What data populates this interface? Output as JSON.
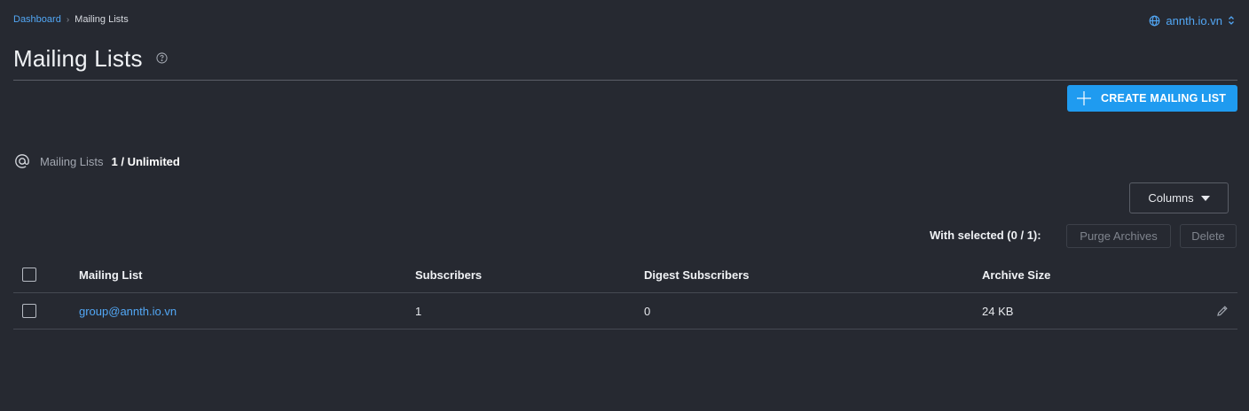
{
  "breadcrumb": {
    "home": "Dashboard",
    "separator": "›",
    "current": "Mailing Lists"
  },
  "domain_switcher": {
    "label": "annth.io.vn",
    "icon": "globe-icon",
    "chevron": "updown-chevron-icon"
  },
  "page": {
    "title": "Mailing Lists",
    "help_icon": "help-circle-icon"
  },
  "actions": {
    "create_label": "CREATE MAILING LIST",
    "create_icon": "plus-icon"
  },
  "usage": {
    "icon": "at-sign-icon",
    "label": "Mailing Lists",
    "value": "1 / Unlimited"
  },
  "toolbar": {
    "columns_label": "Columns",
    "with_selected": "With selected (0 / 1):",
    "purge_label": "Purge Archives",
    "delete_label": "Delete"
  },
  "table": {
    "columns": [
      "Mailing List",
      "Subscribers",
      "Digest Subscribers",
      "Archive Size"
    ],
    "rows": [
      {
        "name": "group@annth.io.vn",
        "subscribers": "1",
        "digest": "0",
        "size": "24 KB",
        "checked": false
      }
    ]
  },
  "colors": {
    "background": "#262931",
    "accent": "#1f9bf0",
    "link": "#52a7f5"
  }
}
